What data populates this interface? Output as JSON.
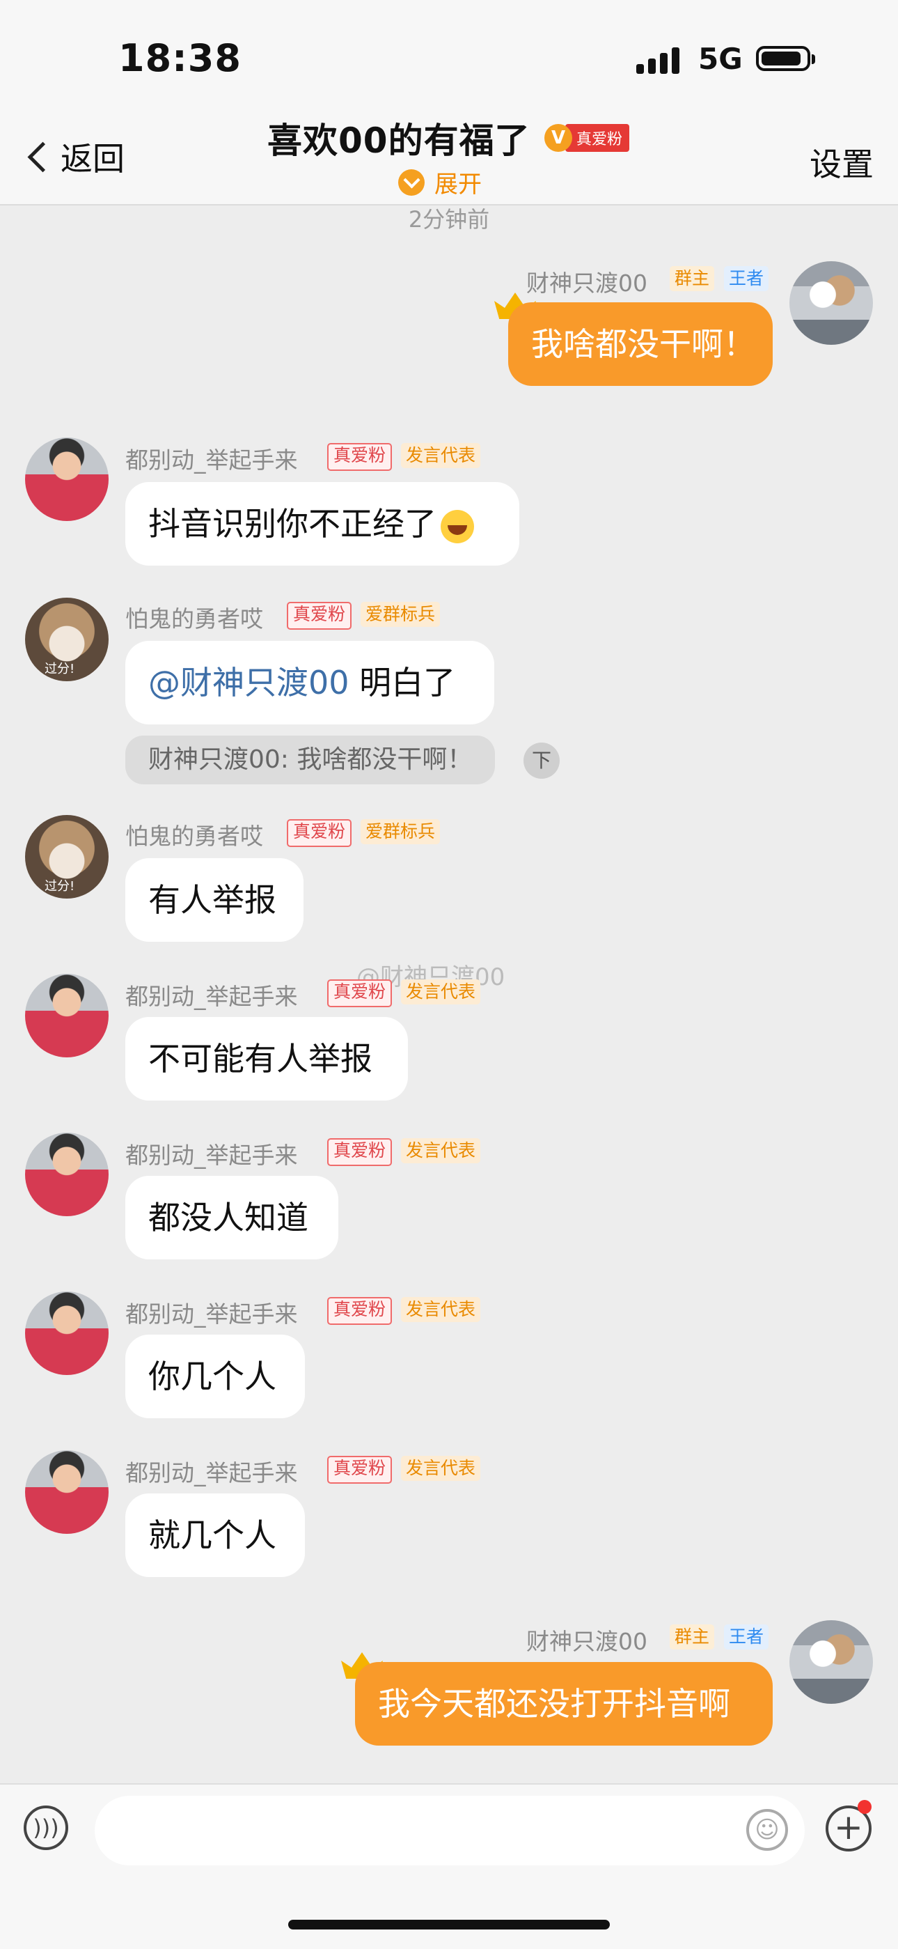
{
  "status_bar": {
    "time": "18:38",
    "network": "5G"
  },
  "nav": {
    "back_label": "返回",
    "title": "喜欢00的有福了",
    "badge_letter": "V",
    "badge_text": "真爱粉",
    "expand_label": "展开",
    "settings_label": "设置"
  },
  "timestamp": "2分钟前",
  "messages": [
    {
      "sender": "财神只渡00",
      "tags": [
        "群主",
        "王者"
      ],
      "text": "我啥都没干啊！",
      "self": true
    },
    {
      "sender": "都别动_举起手来",
      "tags": [
        "真爱粉",
        "发言代表"
      ],
      "text": "抖音识别你不正经了"
    },
    {
      "sender": "怕鬼的勇者哎",
      "tags": [
        "真爱粉",
        "爱群标兵"
      ],
      "mention": "@财神只渡00",
      "text": " 明白了",
      "quote": "财神只渡00: 我啥都没干啊！"
    },
    {
      "sender": "怕鬼的勇者哎",
      "tags": [
        "真爱粉",
        "爱群标兵"
      ],
      "text": "有人举报"
    },
    {
      "sender": "都别动_举起手来",
      "tags": [
        "真爱粉",
        "发言代表"
      ],
      "text": "不可能有人举报"
    },
    {
      "sender": "都别动_举起手来",
      "tags": [
        "真爱粉",
        "发言代表"
      ],
      "text": "都没人知道"
    },
    {
      "sender": "都别动_举起手来",
      "tags": [
        "真爱粉",
        "发言代表"
      ],
      "text": "你几个人"
    },
    {
      "sender": "都别动_举起手来",
      "tags": [
        "真爱粉",
        "发言代表"
      ],
      "text": "就几个人"
    },
    {
      "sender": "财神只渡00",
      "tags": [
        "群主",
        "王者"
      ],
      "text": "我今天都还没打开抖音啊",
      "self": true
    }
  ],
  "avatar_caption": "过分!",
  "quote_icon": "下",
  "watermark": "@财神只渡00",
  "input": {
    "value": ""
  }
}
